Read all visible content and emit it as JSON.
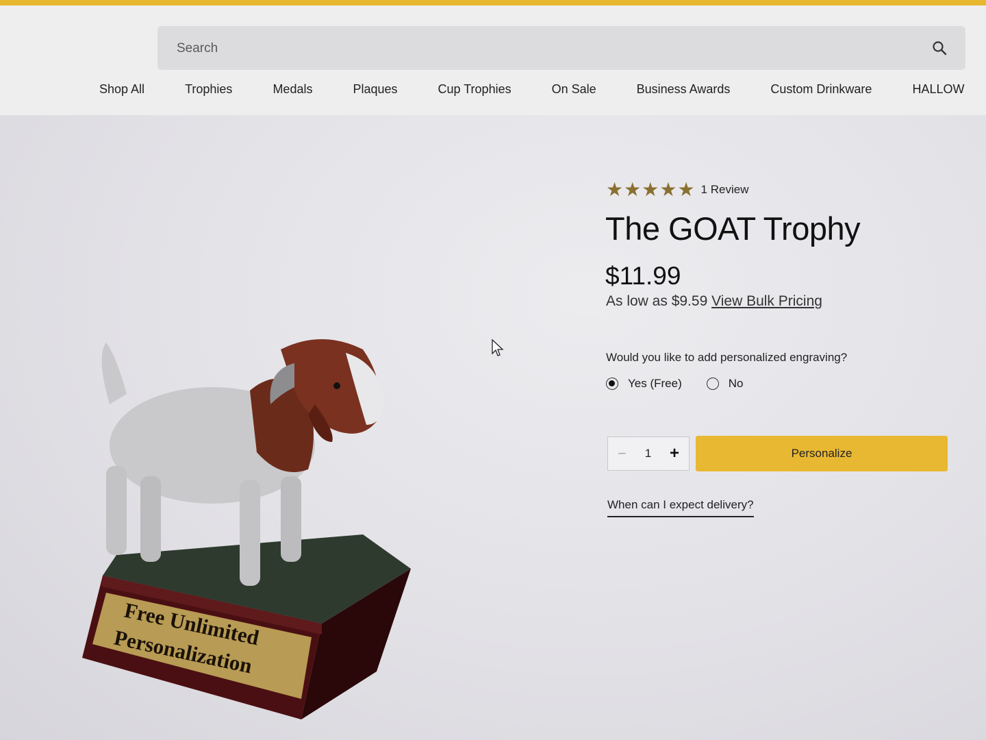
{
  "header": {
    "search": {
      "placeholder": "Search"
    },
    "nav": [
      "Shop All",
      "Trophies",
      "Medals",
      "Plaques",
      "Cup Trophies",
      "On Sale",
      "Business Awards",
      "Custom Drinkware",
      "HALLOW"
    ]
  },
  "product": {
    "image_plate_line1": "Free Unlimited",
    "image_plate_line2": "Personalization",
    "rating": {
      "stars": 5,
      "review_label": "1 Review"
    },
    "title": "The GOAT Trophy",
    "price": "$11.99",
    "bulk_prefix": "As low as $9.59",
    "bulk_link": "View Bulk Pricing",
    "engraving_question": "Would you like to add personalized engraving?",
    "options": [
      {
        "label": "Yes (Free)",
        "selected": true
      },
      {
        "label": "No",
        "selected": false
      }
    ],
    "quantity": "1",
    "personalize_label": "Personalize",
    "delivery_link": "When can I expect delivery?"
  },
  "colors": {
    "accent": "#e9b833",
    "star": "#8a7030"
  }
}
